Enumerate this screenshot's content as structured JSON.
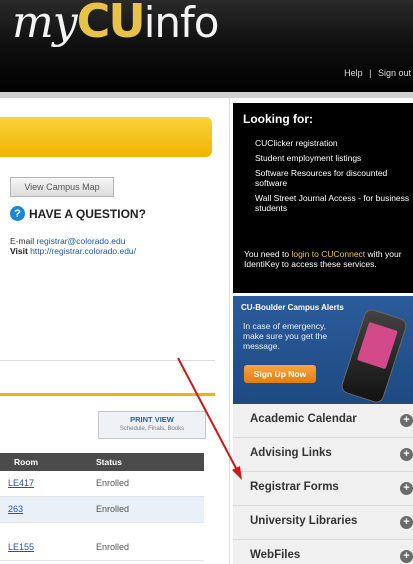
{
  "header": {
    "logo": {
      "my": "my",
      "cu": "CU",
      "info": "info"
    },
    "links": {
      "help": "Help",
      "separator": "|",
      "signout": "Sign out"
    }
  },
  "main": {
    "campus_map_button": "View Campus Map",
    "question_heading": "HAVE A QUESTION?",
    "contact": {
      "email_label": "E-mail",
      "email": "registrar@colorado.edu",
      "visit_label": "Visit",
      "visit_url": "http://registrar.colorado.edu/"
    },
    "print_view": {
      "label": "PRINT VIEW",
      "sub": "Schedule, Finals, Books"
    },
    "table": {
      "headers": [
        "Room",
        "Status"
      ],
      "rows": [
        {
          "room": "LE417",
          "status": "Enrolled"
        },
        {
          "room": "263",
          "status": "Enrolled"
        },
        {
          "room": "LE155",
          "status": "Enrolled"
        }
      ]
    }
  },
  "sidebar": {
    "looking_for": {
      "title": "Looking for:",
      "items": [
        "CUClicker registration",
        "Student employment listings",
        "Software Resources for discounted software",
        "Wall Street Journal Access - for business students"
      ],
      "note_prefix": "You need to",
      "note_link": "login to CUConnect",
      "note_suffix": "with your IdentiKey to access these services."
    },
    "alerts": {
      "title": "CU-Boulder Campus Alerts",
      "text": "In case of emergency, make sure you get the message.",
      "signup": "Sign Up Now"
    },
    "links": [
      "Academic Calendar",
      "Advising Links",
      "Registrar Forms",
      "University Libraries",
      "WebFiles"
    ],
    "link_plus": "+"
  },
  "colors": {
    "gold": "#f0b400",
    "alert_blue": "#2b5c9b",
    "arrow_red": "#cc1a1a",
    "link_blue": "#1f55a6"
  }
}
